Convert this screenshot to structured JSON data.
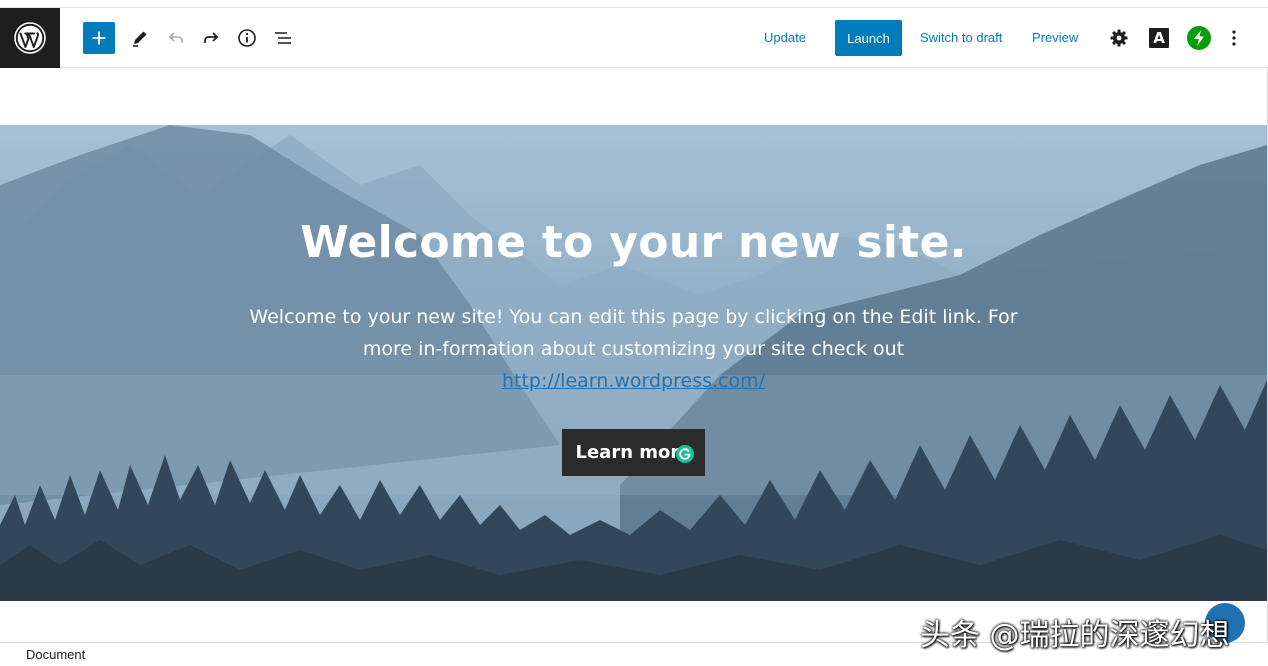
{
  "toolbar": {
    "logo_icon": "wordpress-logo",
    "add_icon": "plus-icon",
    "tools_icon": "pencil-icon",
    "undo_icon": "undo-icon",
    "redo_icon": "redo-icon",
    "info_icon": "info-icon",
    "outline_icon": "list-view-icon",
    "update_label": "Update",
    "launch_label": "Launch",
    "switch_draft_label": "Switch to draft",
    "preview_label": "Preview",
    "settings_icon": "gear-icon",
    "a_label": "A",
    "jetpack_icon": "lightning-bolt-icon",
    "more_icon": "vertical-ellipsis-icon",
    "accent_color": "#007cba"
  },
  "hero": {
    "title": "Welcome to your new site.",
    "description_before": "Welcome to your new site! You can edit this page by clicking on the Edit link. For more in-formation about customizing your site check out ",
    "link_text": "http://learn.wordpress.com/",
    "button_label": "Learn more"
  },
  "footer": {
    "breadcrumb": "Document"
  },
  "watermark": "头条 @瑞拉的深邃幻想"
}
